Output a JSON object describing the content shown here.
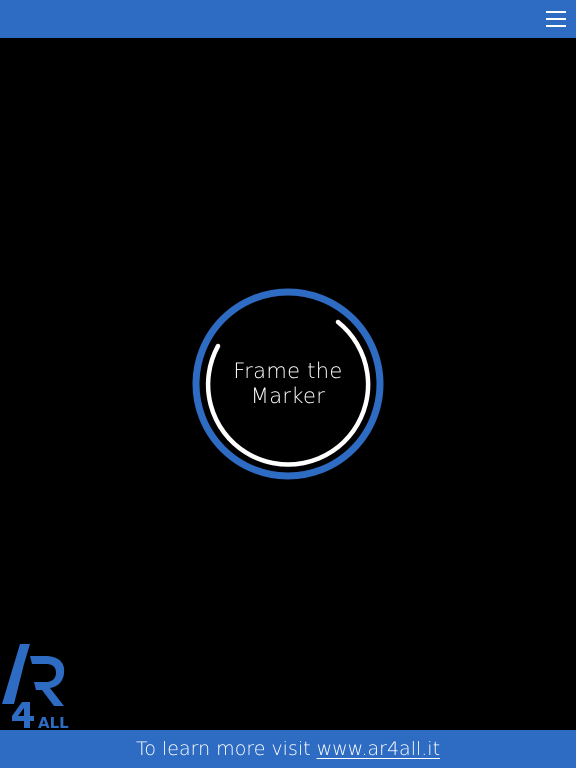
{
  "header": {
    "menu_icon": "hamburger-menu-icon"
  },
  "scanner": {
    "line1": "Frame the",
    "line2": "Marker",
    "ring_color": "#2e6bc2",
    "arc_color": "#ffffff"
  },
  "logo": {
    "text": "AR4ALL",
    "color": "#2e6bc2"
  },
  "footer": {
    "text": "To learn more visit",
    "link": "www.ar4all.it"
  },
  "colors": {
    "brand_blue": "#2e6bc2",
    "background": "#000000",
    "text": "#ffffff"
  }
}
